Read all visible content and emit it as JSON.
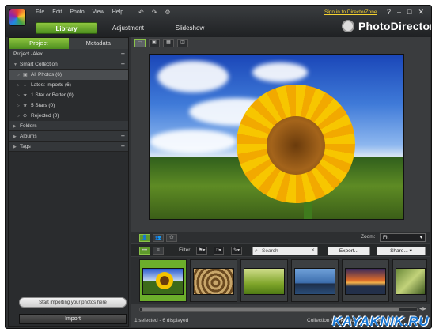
{
  "menu": [
    "File",
    "Edit",
    "Photo",
    "View",
    "Help"
  ],
  "signin": "Sign in to DirectorZone",
  "mode_tabs": [
    "Library",
    "Adjustment",
    "Slideshow"
  ],
  "brand": "PhotoDirector",
  "left_tabs": [
    "Project",
    "Metadata"
  ],
  "project_title": "Project -Alex",
  "smart_collection": "Smart Collection",
  "collection_items": [
    "All Photos (6)",
    "Latest Imports (6)",
    "1 Star or Better (0)",
    "5 Stars (0)",
    "Rejected (0)"
  ],
  "folders": "Folders",
  "albums": "Albums",
  "tags": "Tags",
  "import_hint": "Start importing your photos here",
  "import_button": "Import",
  "zoom_label": "Zoom:",
  "zoom_value": "Fit",
  "filter_label": "Filter:",
  "search_placeholder": "Search",
  "export_label": "Export...",
  "share_label": "Share...",
  "status_left": "1 selected - 6 displayed",
  "status_right": "Collection / All Photos / Sun Flower.",
  "watermark": "KAYAKNIK.RU"
}
